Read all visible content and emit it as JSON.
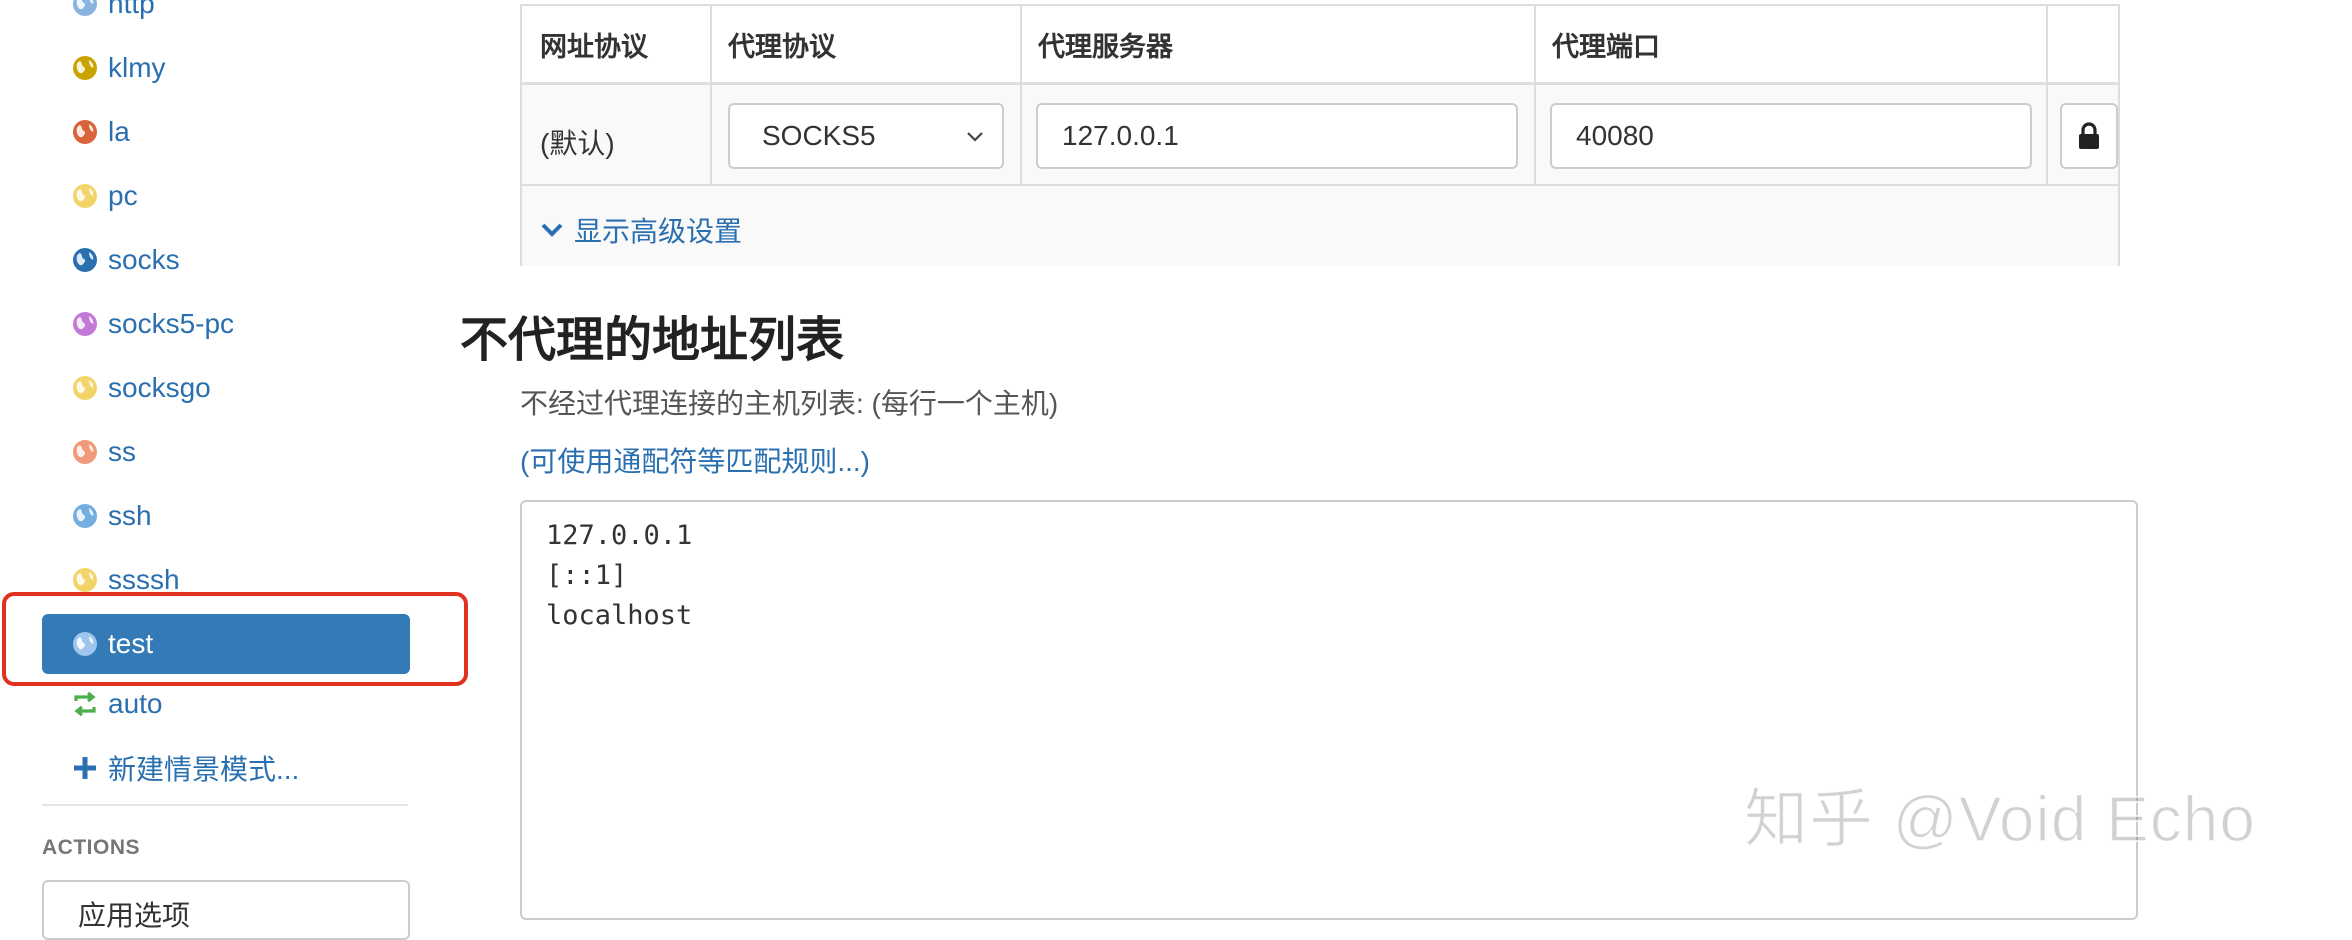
{
  "sidebar": {
    "profiles": [
      {
        "label": "http",
        "color": "#8ab4e0"
      },
      {
        "label": "klmy",
        "color": "#c9a400"
      },
      {
        "label": "la",
        "color": "#d9643a"
      },
      {
        "label": "pc",
        "color": "#f2d46a"
      },
      {
        "label": "socks",
        "color": "#2a6fb0"
      },
      {
        "label": "socks5-pc",
        "color": "#c27ad6"
      },
      {
        "label": "socksgo",
        "color": "#f2d46a"
      },
      {
        "label": "ss",
        "color": "#f09a7a"
      },
      {
        "label": "ssh",
        "color": "#74aee0"
      },
      {
        "label": "ssssh",
        "color": "#f2d46a"
      },
      {
        "label": "test",
        "color": "#9ec5ee",
        "active": true
      }
    ],
    "auto": {
      "label": "auto",
      "color": "#4cae4c"
    },
    "new_profile": {
      "label": "新建情景模式..."
    },
    "actions_heading": "ACTIONS",
    "actions_button_label": "应用选项"
  },
  "proxy_table": {
    "headers": [
      "网址协议",
      "代理协议",
      "代理服务器",
      "代理端口"
    ],
    "row": {
      "scheme": "(默认)",
      "protocol": "SOCKS5",
      "server": "127.0.0.1",
      "port": "40080"
    },
    "advanced_toggle": "显示高级设置"
  },
  "bypass": {
    "title": "不代理的地址列表",
    "description": "不经过代理连接的主机列表: (每行一个主机)",
    "wildcard_link": "(可使用通配符等匹配规则...)",
    "textarea_value": "127.0.0.1\n[::1]\nlocalhost"
  },
  "watermark": "知乎 @Void Echo",
  "colors": {
    "accent": "#337ab7",
    "link": "#2a6fb0",
    "highlight_border": "#e0301e"
  }
}
